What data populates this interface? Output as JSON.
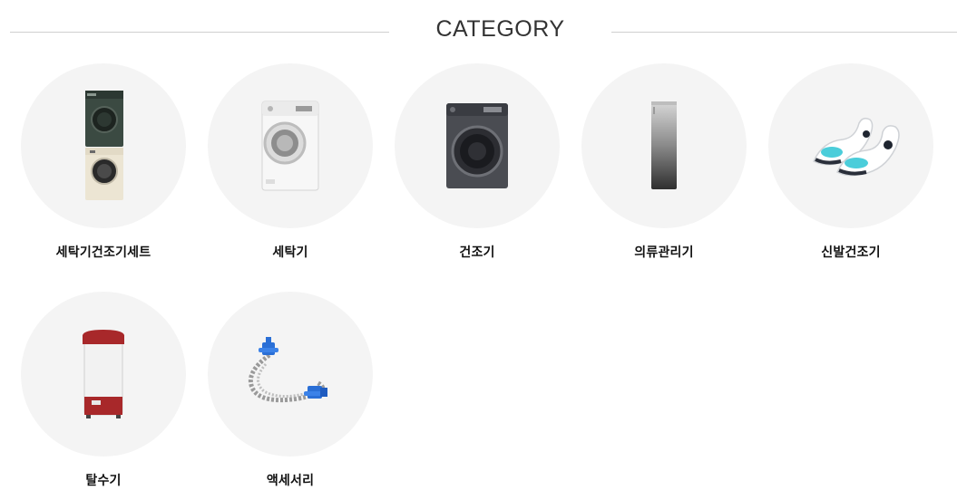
{
  "header": {
    "title": "CATEGORY"
  },
  "categories": [
    {
      "label": "세탁기건조기세트",
      "icon": "washer-dryer-set-icon"
    },
    {
      "label": "세탁기",
      "icon": "washing-machine-icon"
    },
    {
      "label": "건조기",
      "icon": "dryer-icon"
    },
    {
      "label": "의류관리기",
      "icon": "clothing-care-icon"
    },
    {
      "label": "신발건조기",
      "icon": "shoe-dryer-icon"
    },
    {
      "label": "탈수기",
      "icon": "spin-dryer-icon"
    },
    {
      "label": "액세서리",
      "icon": "hose-accessory-icon"
    }
  ],
  "colors": {
    "circle_bg": "#f4f4f4",
    "divider": "#cfcfcf",
    "title": "#333333",
    "label": "#111111"
  }
}
